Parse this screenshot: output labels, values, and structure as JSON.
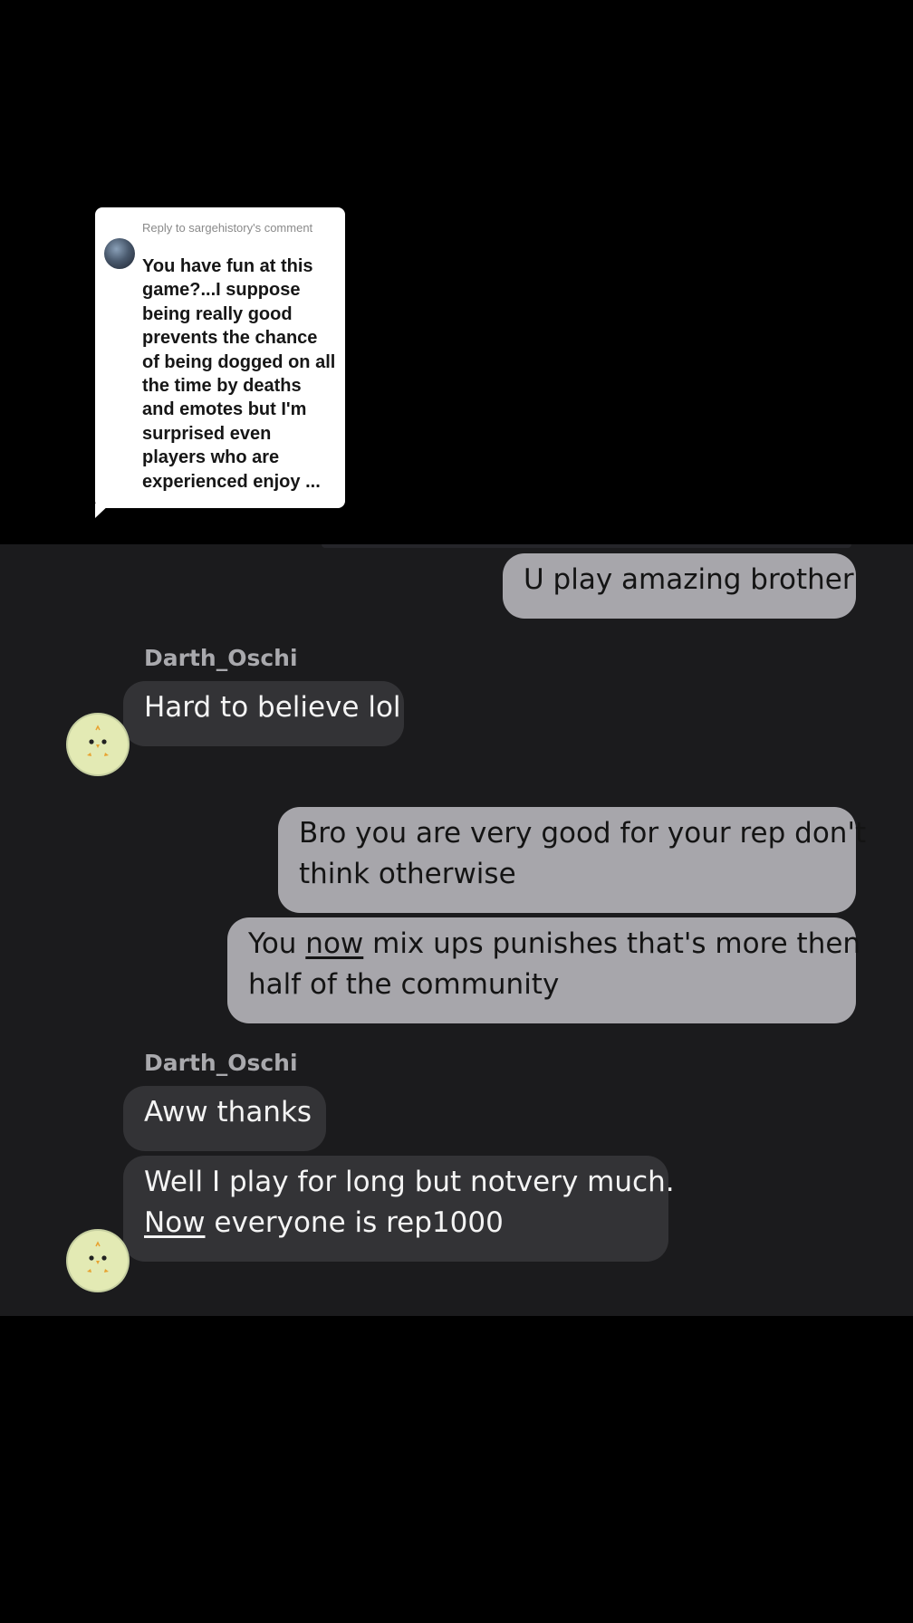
{
  "reply_card": {
    "label": "Reply to sargehistory's comment",
    "text": "You have fun at this game?...I suppose being really good prevents the chance of being dogged on all the time by deaths and emotes but I'm surprised even players who are experienced enjoy ..."
  },
  "messages": {
    "m1": "U play amazing brother",
    "sender1": "Darth_Oschi",
    "m2": "Hard to believe lol",
    "m3_line1": "Bro you are very good for your rep don't",
    "m3_line2": "think otherwise",
    "m4_pre": "You ",
    "m4_underlined": "now",
    "m4_post": " mix ups punishes that's more then",
    "m4_line2": "half of the community",
    "sender2": "Darth_Oschi",
    "m5": "Aww thanks",
    "m6_line1": "Well I play for long but notvery much.",
    "m6_underlined": "Now",
    "m6_rest": " everyone is rep1000"
  },
  "icons": {
    "reply_avatar": "user-photo-avatar",
    "chat_avatar": "chick-avatar-icon"
  },
  "colors": {
    "background": "#000000",
    "chat_background": "#1b1b1d",
    "sent_bubble": "#a7a6ab",
    "received_bubble": "#333336",
    "sender_name": "#a9a9ad"
  }
}
